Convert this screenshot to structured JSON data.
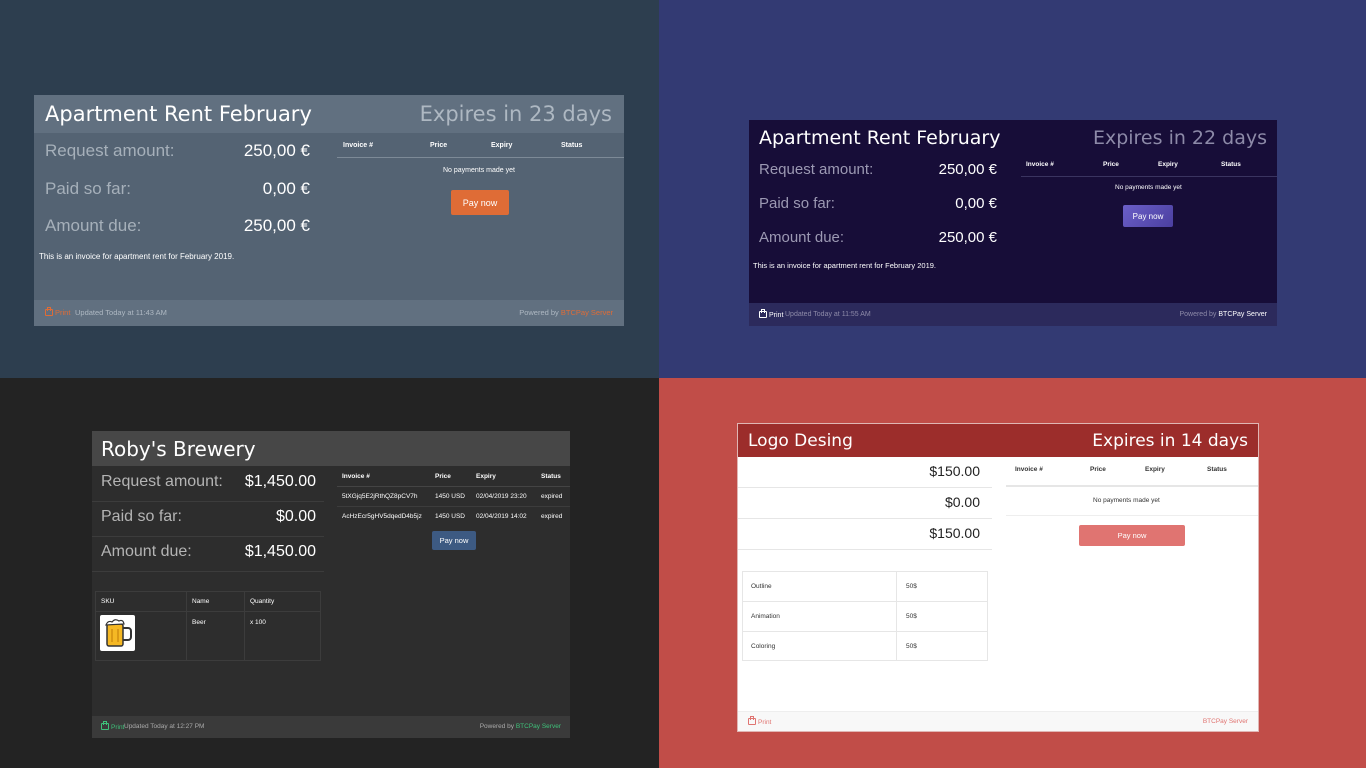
{
  "panels": [
    {
      "theme": "slate",
      "title": "Apartment Rent February",
      "expires": "Expires in 23 days",
      "request_label": "Request amount:",
      "request_value": "250,00 €",
      "paid_label": "Paid so far:",
      "paid_value": "0,00 €",
      "due_label": "Amount due:",
      "due_value": "250,00 €",
      "description": "This is an invoice for apartment rent for February 2019.",
      "table_headers": [
        "Invoice #",
        "Price",
        "Expiry",
        "Status"
      ],
      "no_payments": "No payments made yet",
      "pay_button": "Pay now",
      "footer_print": "Print",
      "footer_updated": "Updated Today at 11:43 AM",
      "footer_powered": "Powered by",
      "footer_brand": "BTCPay Server",
      "colors": {
        "background": "#2d3e4f",
        "card": "#546373",
        "header": "#617080",
        "accent": "#df6c36"
      }
    },
    {
      "theme": "indigo",
      "title": "Apartment Rent February",
      "expires": "Expires in 22 days",
      "request_label": "Request amount:",
      "request_value": "250,00 €",
      "paid_label": "Paid so far:",
      "paid_value": "0,00 €",
      "due_label": "Amount due:",
      "due_value": "250,00 €",
      "description": "This is an invoice for apartment rent for February 2019.",
      "table_headers": [
        "Invoice #",
        "Price",
        "Expiry",
        "Status"
      ],
      "no_payments": "No payments made yet",
      "pay_button": "Pay now",
      "footer_print": "Print",
      "footer_updated": "Updated Today at 11:55 AM",
      "footer_powered": "Powered by",
      "footer_brand": "BTCPay Server",
      "colors": {
        "background": "#333a73",
        "card": "#170d38",
        "footer": "#2c2a5c",
        "accent": "#5a4eb5"
      }
    },
    {
      "theme": "dark",
      "title": "Roby's Brewery",
      "request_label": "Request amount:",
      "request_value": "$1,450.00",
      "paid_label": "Paid so far:",
      "paid_value": "$0.00",
      "due_label": "Amount due:",
      "due_value": "$1,450.00",
      "table_headers": [
        "Invoice #",
        "Price",
        "Expiry",
        "Status"
      ],
      "invoices": [
        {
          "id": "5tXGjq5E2jRthQZ8pCV7h",
          "price": "1450 USD",
          "expiry": "02/04/2019 23:20",
          "status": "expired"
        },
        {
          "id": "AcHzEcr5gHV5dqedD4b5jz",
          "price": "1450 USD",
          "expiry": "02/04/2019 14:02",
          "status": "expired"
        }
      ],
      "pay_button": "Pay now",
      "items_headers": [
        "SKU",
        "Name",
        "Quantity"
      ],
      "items": [
        {
          "sku_icon": "beer-mug-icon",
          "name": "Beer",
          "quantity": "x 100"
        }
      ],
      "footer_print": "Print",
      "footer_updated": "Updated Today at 12:27 PM",
      "footer_powered": "Powered by",
      "footer_brand": "BTCPay Server",
      "colors": {
        "background": "#232323",
        "card": "#2d2d2d",
        "header": "#474747",
        "accent": "#3d5a82",
        "brand": "#3ec27a"
      }
    },
    {
      "theme": "light-red",
      "title": "Logo Desing",
      "expires": "Expires in 14 days",
      "request_value": "$150.00",
      "paid_value": "$0.00",
      "due_value": "$150.00",
      "table_headers": [
        "Invoice #",
        "Price",
        "Expiry",
        "Status"
      ],
      "no_payments": "No payments made yet",
      "pay_button": "Pay now",
      "line_items": [
        {
          "name": "Outline",
          "price": "50$"
        },
        {
          "name": "Animation",
          "price": "50$"
        },
        {
          "name": "Coloring",
          "price": "50$"
        }
      ],
      "footer_print": "Print",
      "footer_brand": "BTCPay Server",
      "colors": {
        "background": "#c14d48",
        "card": "#ffffff",
        "header": "#9c2d2b",
        "accent": "#e07471"
      }
    }
  ]
}
